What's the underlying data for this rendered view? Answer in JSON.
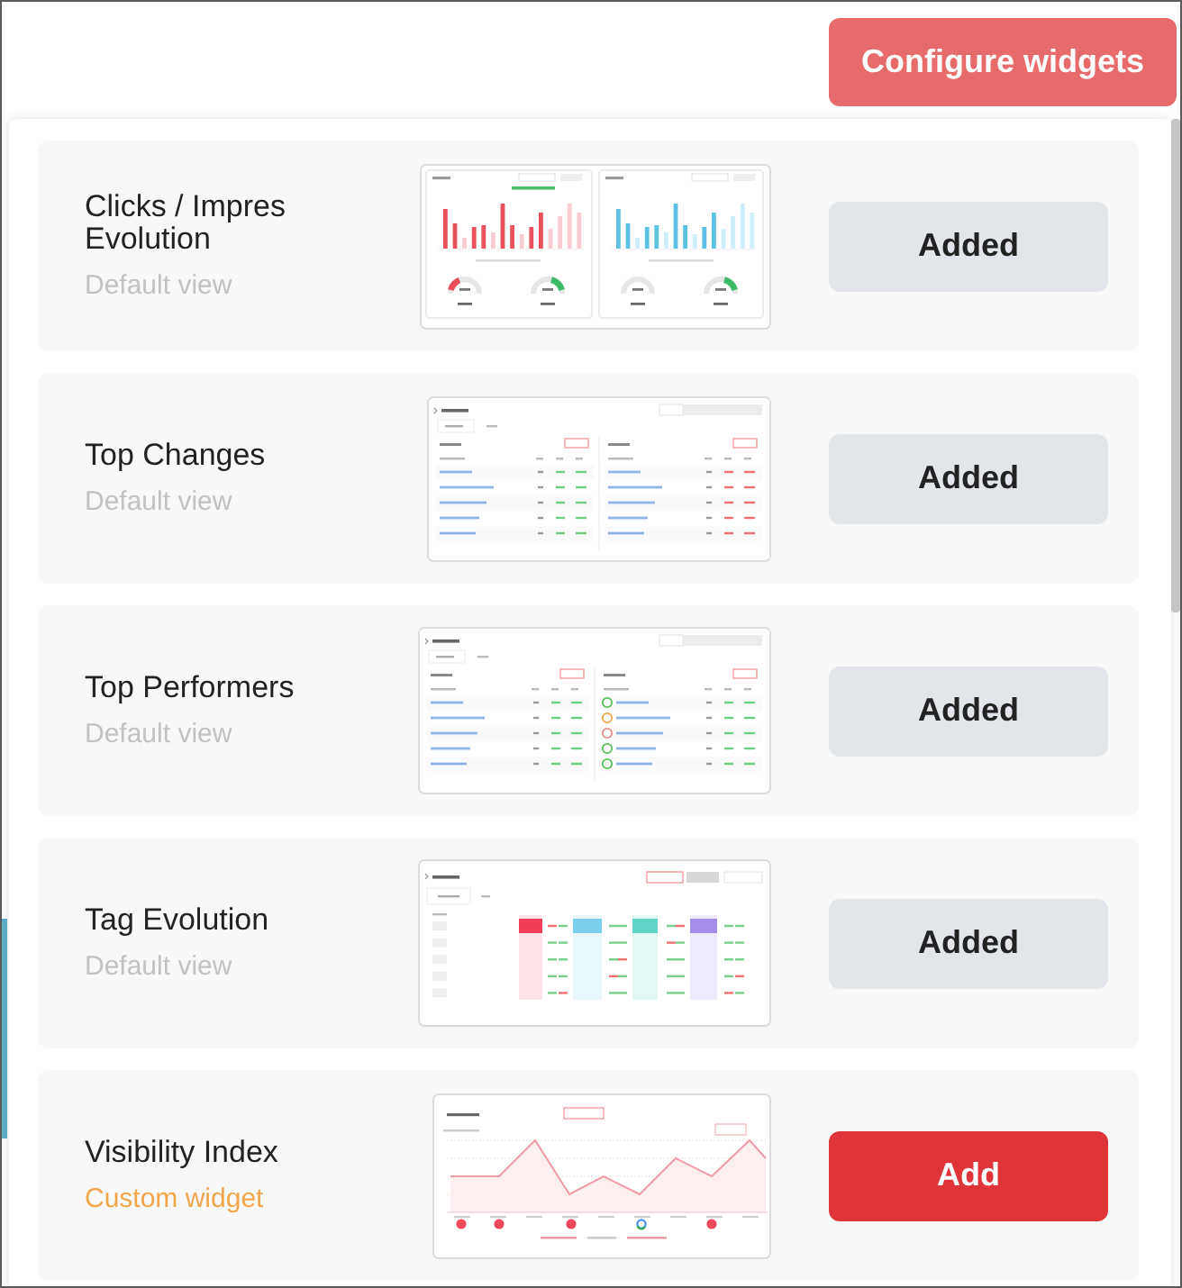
{
  "header": {
    "configure_button": "Configure widgets"
  },
  "widgets": [
    {
      "title": "Clicks / Impres Evolution",
      "subtitle": "Default view",
      "custom": false,
      "kind": "bars",
      "added": true,
      "button": "Added"
    },
    {
      "title": "Top Changes",
      "subtitle": "Default view",
      "custom": false,
      "kind": "table",
      "added": true,
      "button": "Added"
    },
    {
      "title": "Top Performers",
      "subtitle": "Default view",
      "custom": false,
      "kind": "ranked",
      "added": true,
      "button": "Added"
    },
    {
      "title": "Tag Evolution",
      "subtitle": "Default view",
      "custom": false,
      "kind": "heatmap",
      "added": true,
      "button": "Added"
    },
    {
      "title": "Visibility Index",
      "subtitle": "Custom widget",
      "custom": true,
      "kind": "line",
      "added": false,
      "button": "Add"
    }
  ]
}
